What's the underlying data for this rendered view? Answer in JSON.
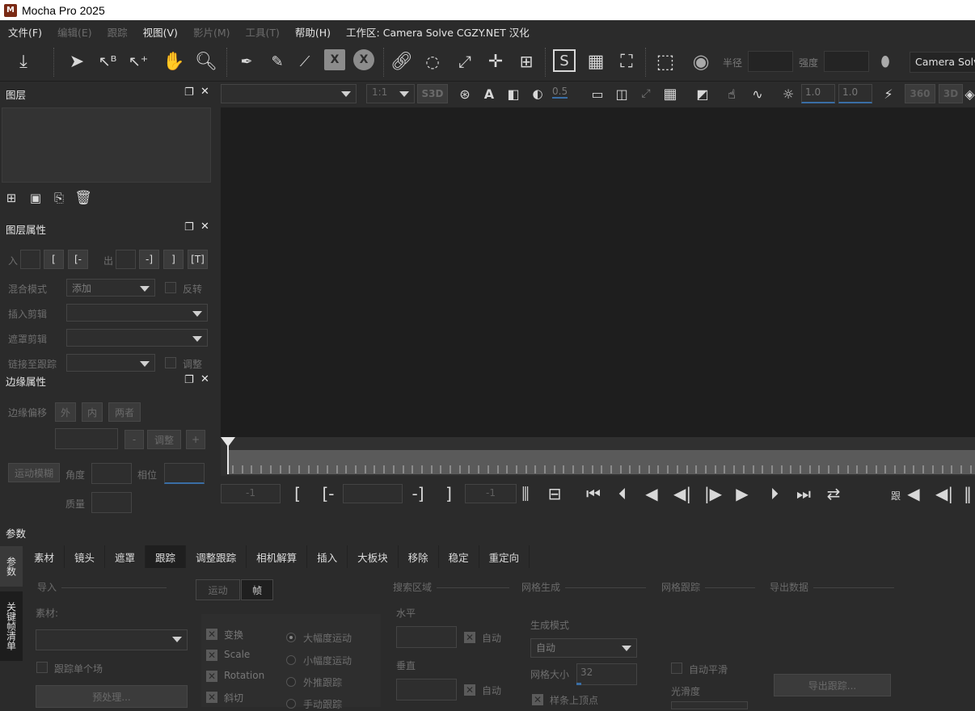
{
  "app": {
    "title": "Mocha Pro 2025",
    "logo_letter": "M"
  },
  "menu": {
    "file": "文件(F)",
    "edit": "编辑(E)",
    "track": "跟踪",
    "view": "视图(V)",
    "clip": "影片(M)",
    "tools": "工具(T)",
    "help": "帮助(H)",
    "workspace_info": "工作区: Camera Solve  CGZY.NET 汉化"
  },
  "toolbar": {
    "radius_label": "半径",
    "strength_label": "强度",
    "workspace": "Camera Solve",
    "zoom": "1:1",
    "s3d": "S3D",
    "opacity": "0.5",
    "exposure": "1.0",
    "gamma": "1.0",
    "v360": "360",
    "v3d": "3D"
  },
  "layers_panel": {
    "title": "图层"
  },
  "layer_props": {
    "title": "图层属性",
    "in_label": "入",
    "out_label": "出",
    "blend_label": "混合模式",
    "blend_value": "添加",
    "invert_label": "反转",
    "insert_clip_label": "插入剪辑",
    "mask_clip_label": "遮罩剪辑",
    "link_track_label": "链接至跟踪",
    "adjust_label": "调整"
  },
  "edge_props": {
    "title": "边缘属性",
    "offset_label": "边缘偏移",
    "out_btn": "外",
    "in_btn": "内",
    "both_btn": "两者",
    "minus": "-",
    "adjust_btn": "调整",
    "plus": "+",
    "motion_blur_btn": "运动模糊",
    "angle_label": "角度",
    "phase_label": "相位",
    "quality_label": "质量"
  },
  "timeline": {
    "start_value": "-1",
    "end_value": "-1",
    "track_label": "跟"
  },
  "params": {
    "title": "参数",
    "side_tab_params": "参数",
    "side_tab_keyframes": "关键帧清单",
    "tabs": [
      "素材",
      "镜头",
      "遮罩",
      "跟踪",
      "调整跟踪",
      "相机解算",
      "插入",
      "大板块",
      "移除",
      "稳定",
      "重定向"
    ],
    "import_section": "导入",
    "clip_label": "素材:",
    "track_single_frame": "跟踪单个场",
    "preprocess_btn": "预处理...",
    "motion_tab": "运动",
    "frame_tab": "帧",
    "motion_options": [
      "变换",
      "Scale",
      "Rotation",
      "斜切"
    ],
    "motion_modes": [
      "大幅度运动",
      "小幅度运动",
      "外推跟踪",
      "手动跟踪"
    ],
    "search_section": "搜索区域",
    "horizontal_label": "水平",
    "vertical_label": "垂直",
    "auto_label": "自动",
    "mesh_gen_section": "网格生成",
    "gen_mode_label": "生成模式",
    "gen_mode_value": "自动",
    "mesh_size_label": "网格大小",
    "mesh_size_value": "32",
    "spline_vertex": "样条上顶点",
    "mesh_track_section": "网格跟踪",
    "auto_smooth": "自动平滑",
    "smoothness_label": "光滑度",
    "export_section": "导出数据",
    "export_btn": "导出跟踪..."
  }
}
